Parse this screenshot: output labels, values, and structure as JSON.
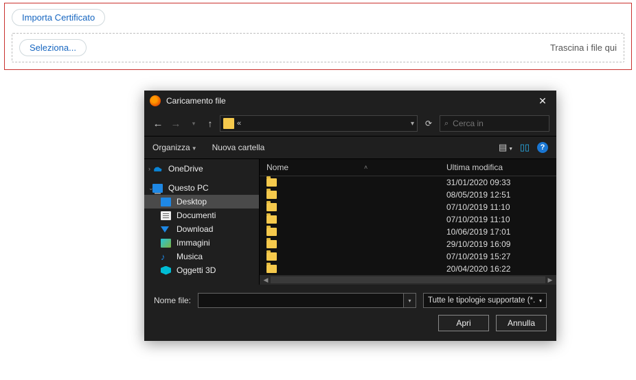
{
  "panel": {
    "import_label": "Importa Certificato",
    "select_label": "Seleziona...",
    "drag_text": "Trascina i file qui"
  },
  "dialog": {
    "title": "Caricamento file",
    "address_prefix": "«",
    "search_placeholder": "Cerca in",
    "organize_label": "Organizza",
    "new_folder_label": "Nuova cartella",
    "columns": {
      "name": "Nome",
      "modified": "Ultima modifica"
    },
    "sidebar": [
      {
        "label": "OneDrive",
        "icon": "onedrive",
        "chev": ">",
        "root": true
      },
      {
        "label": "Questo PC",
        "icon": "pc",
        "chev": "v",
        "root": true
      },
      {
        "label": "Desktop",
        "icon": "desktop",
        "selected": true
      },
      {
        "label": "Documenti",
        "icon": "doc"
      },
      {
        "label": "Download",
        "icon": "down"
      },
      {
        "label": "Immagini",
        "icon": "img"
      },
      {
        "label": "Musica",
        "icon": "music"
      },
      {
        "label": "Oggetti 3D",
        "icon": "3d"
      }
    ],
    "files": [
      {
        "modified": "31/01/2020 09:33"
      },
      {
        "modified": "08/05/2019 12:51"
      },
      {
        "modified": "07/10/2019 11:10"
      },
      {
        "modified": "07/10/2019 11:10"
      },
      {
        "modified": "10/06/2019 17:01"
      },
      {
        "modified": "29/10/2019 16:09"
      },
      {
        "modified": "07/10/2019 15:27"
      },
      {
        "modified": "20/04/2020 16:22"
      }
    ],
    "filename_label": "Nome file:",
    "filter_label": "Tutte le tipologie supportate (*.",
    "open_label": "Apri",
    "cancel_label": "Annulla"
  }
}
